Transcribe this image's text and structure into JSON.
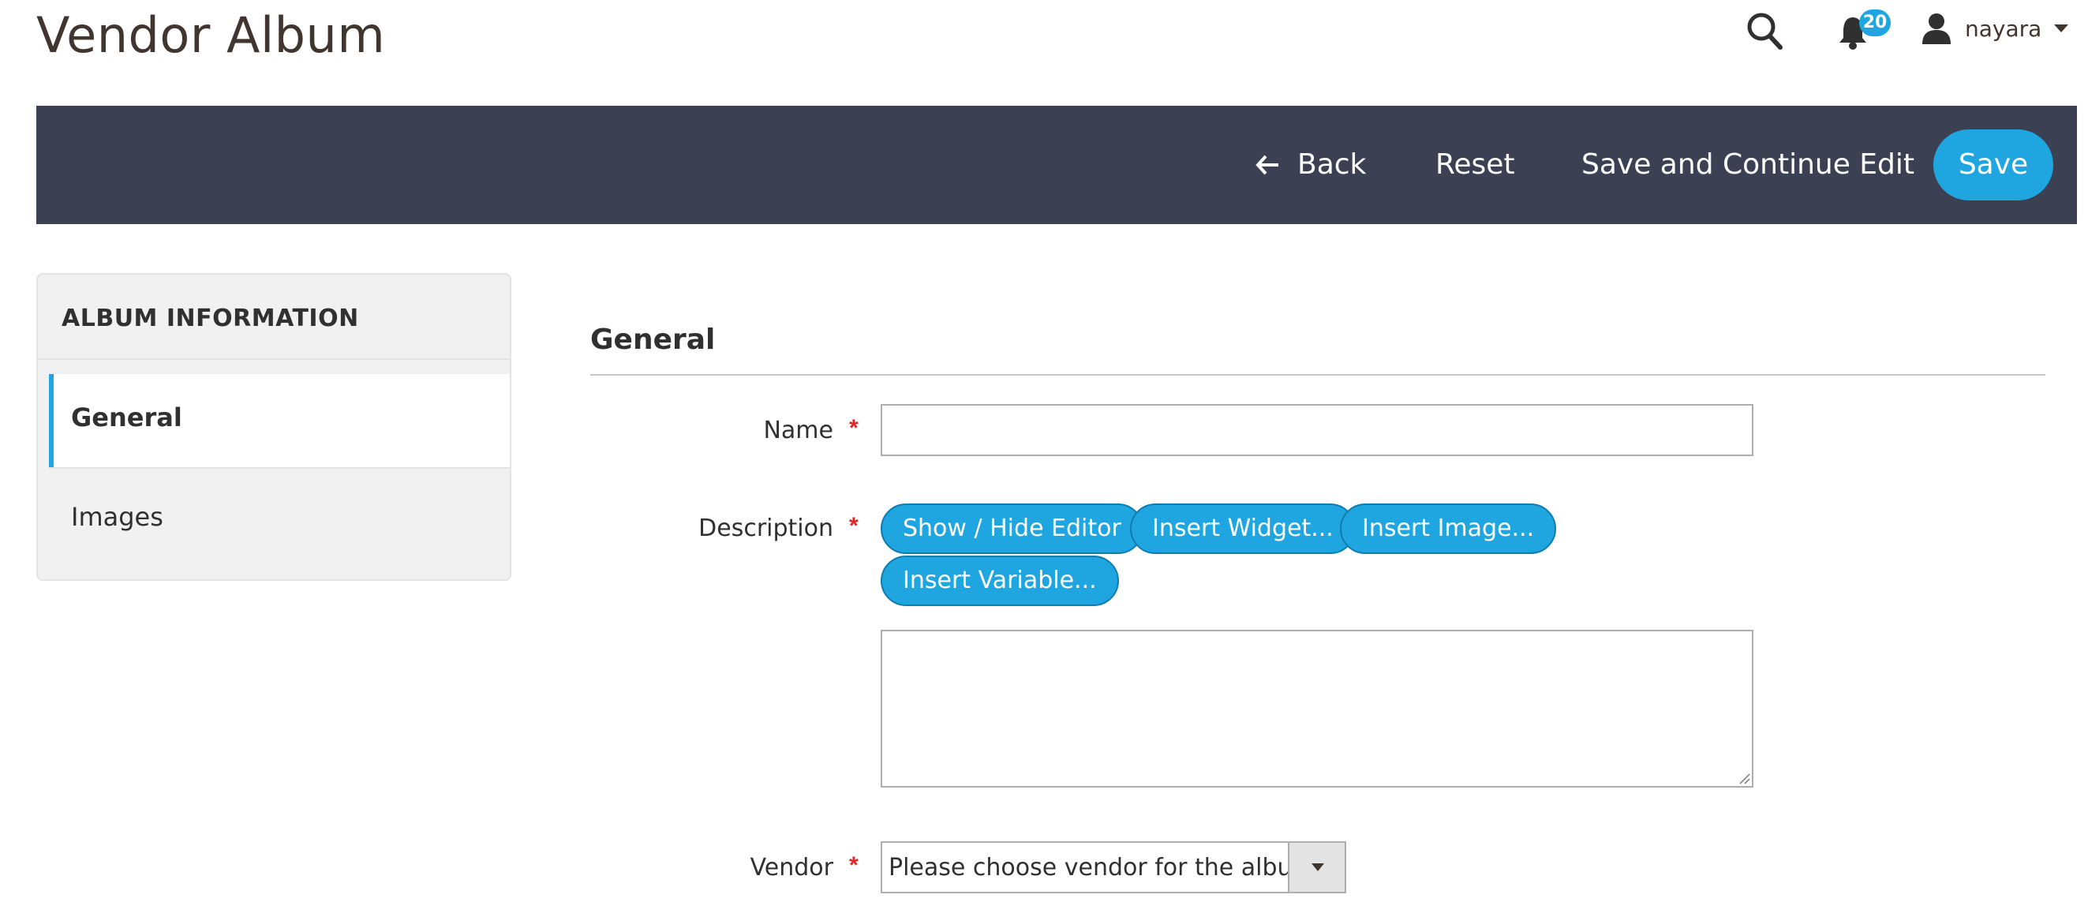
{
  "header": {
    "title": "Vendor Album",
    "notifications_count": "20",
    "user_name": "nayara"
  },
  "toolbar": {
    "back_label": "Back",
    "reset_label": "Reset",
    "save_continue_label": "Save and Continue Edit",
    "save_label": "Save"
  },
  "sidebar": {
    "heading": "ALBUM INFORMATION",
    "items": [
      {
        "label": "General",
        "active": true
      },
      {
        "label": "Images",
        "active": false
      }
    ]
  },
  "form": {
    "section_title": "General",
    "name": {
      "label": "Name",
      "required": true,
      "value": ""
    },
    "description": {
      "label": "Description",
      "required": true,
      "value": "",
      "buttons": [
        "Show / Hide Editor",
        "Insert Widget...",
        "Insert Image...",
        "Insert Variable..."
      ]
    },
    "vendor": {
      "label": "Vendor",
      "required": true,
      "selected": "Please choose vendor for the album"
    }
  },
  "colors": {
    "accent": "#1fa6e0",
    "toolbar_bg": "#3b4153",
    "required_star": "#e22626"
  }
}
